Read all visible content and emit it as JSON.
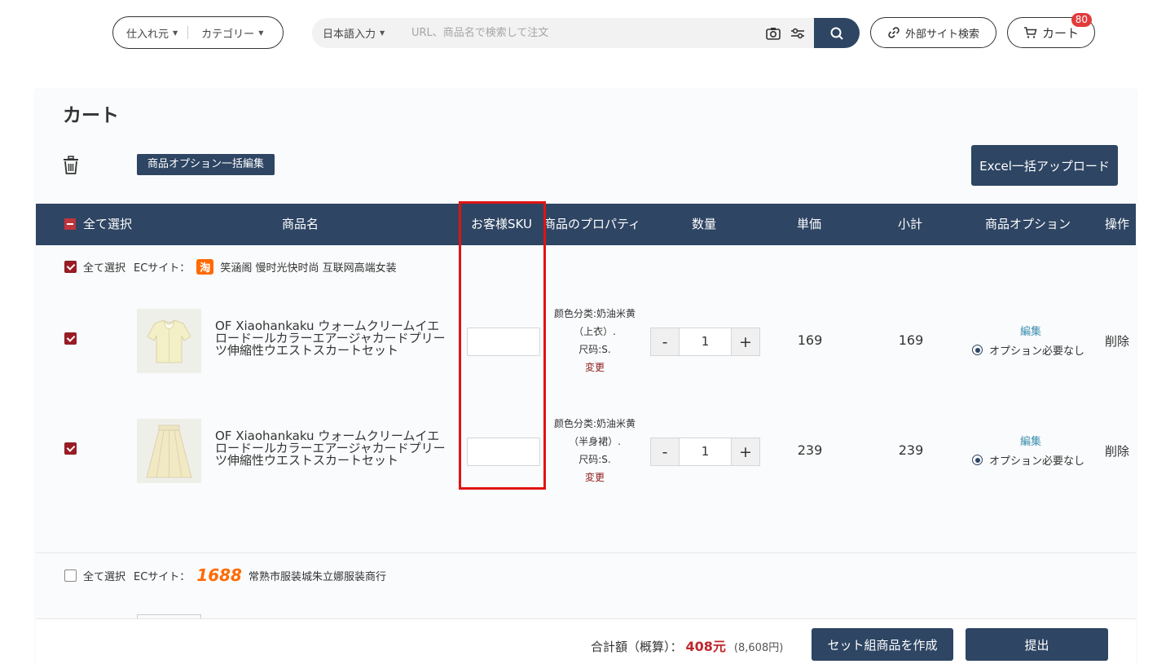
{
  "header": {
    "source_label": "仕入れ元",
    "category_label": "カテゴリー",
    "language_label": "日本語入力",
    "search_placeholder": "URL、商品名で検索して注文",
    "external_search_label": "外部サイト検索",
    "cart_label": "カート",
    "cart_count": "80"
  },
  "page": {
    "title": "カート",
    "bulk_option_label": "商品オプション一括編集",
    "excel_upload_label": "Excel一括アップロード"
  },
  "table": {
    "headers": {
      "select_all": "全て選択",
      "product_name": "商品名",
      "customer_sku": "お客様SKU",
      "property": "商品のプロパティ",
      "quantity": "数量",
      "unit_price": "単価",
      "subtotal": "小計",
      "product_option": "商品オプション",
      "operation": "操作"
    }
  },
  "shops": [
    {
      "select_all": "全て選択",
      "ec_label": "ECサイト：",
      "platform_icon": "taobao-icon",
      "platform_glyph": "淘",
      "shop_name": "笑涵阁 慢时光快时尚 互联网高端女装",
      "items": [
        {
          "name": "OF Xiaohankaku ウォームクリームイエロードールカラーエアージャカードプリーツ伸縮性ウエストスカートセット",
          "prop_line1": "颜色分类:奶油米黄",
          "prop_line2": "（上衣）.",
          "prop_line3": "尺码:S.",
          "change": "変更",
          "qty": "1",
          "minus": "-",
          "plus": "+",
          "unit_price": "169",
          "subtotal": "169",
          "edit": "編集",
          "option": "オプション必要なし",
          "delete": "削除"
        },
        {
          "name": "OF Xiaohankaku ウォームクリームイエロードールカラーエアージャカードプリーツ伸縮性ウエストスカートセット",
          "prop_line1": "颜色分类:奶油米黄",
          "prop_line2": "（半身裙）.",
          "prop_line3": "尺码:S.",
          "change": "変更",
          "qty": "1",
          "minus": "-",
          "plus": "+",
          "unit_price": "239",
          "subtotal": "239",
          "edit": "編集",
          "option": "オプション必要なし",
          "delete": "削除"
        }
      ]
    },
    {
      "select_all": "全て選択",
      "ec_label": "ECサイト：",
      "platform_icon": "1688-logo",
      "platform_glyph": "1688",
      "shop_name": "常熟市服装城朱立娜服装商行"
    }
  ],
  "footer": {
    "total_label": "合計額（概算）：",
    "total_amount": "408元",
    "total_yen": "(8,608円)",
    "set_button": "セット組商品を作成",
    "submit_button": "提出"
  },
  "colors": {
    "navy": "#2e4563",
    "accent_red": "#c0262c",
    "highlight": "#e01414",
    "brand_orange": "#ff6a00"
  }
}
